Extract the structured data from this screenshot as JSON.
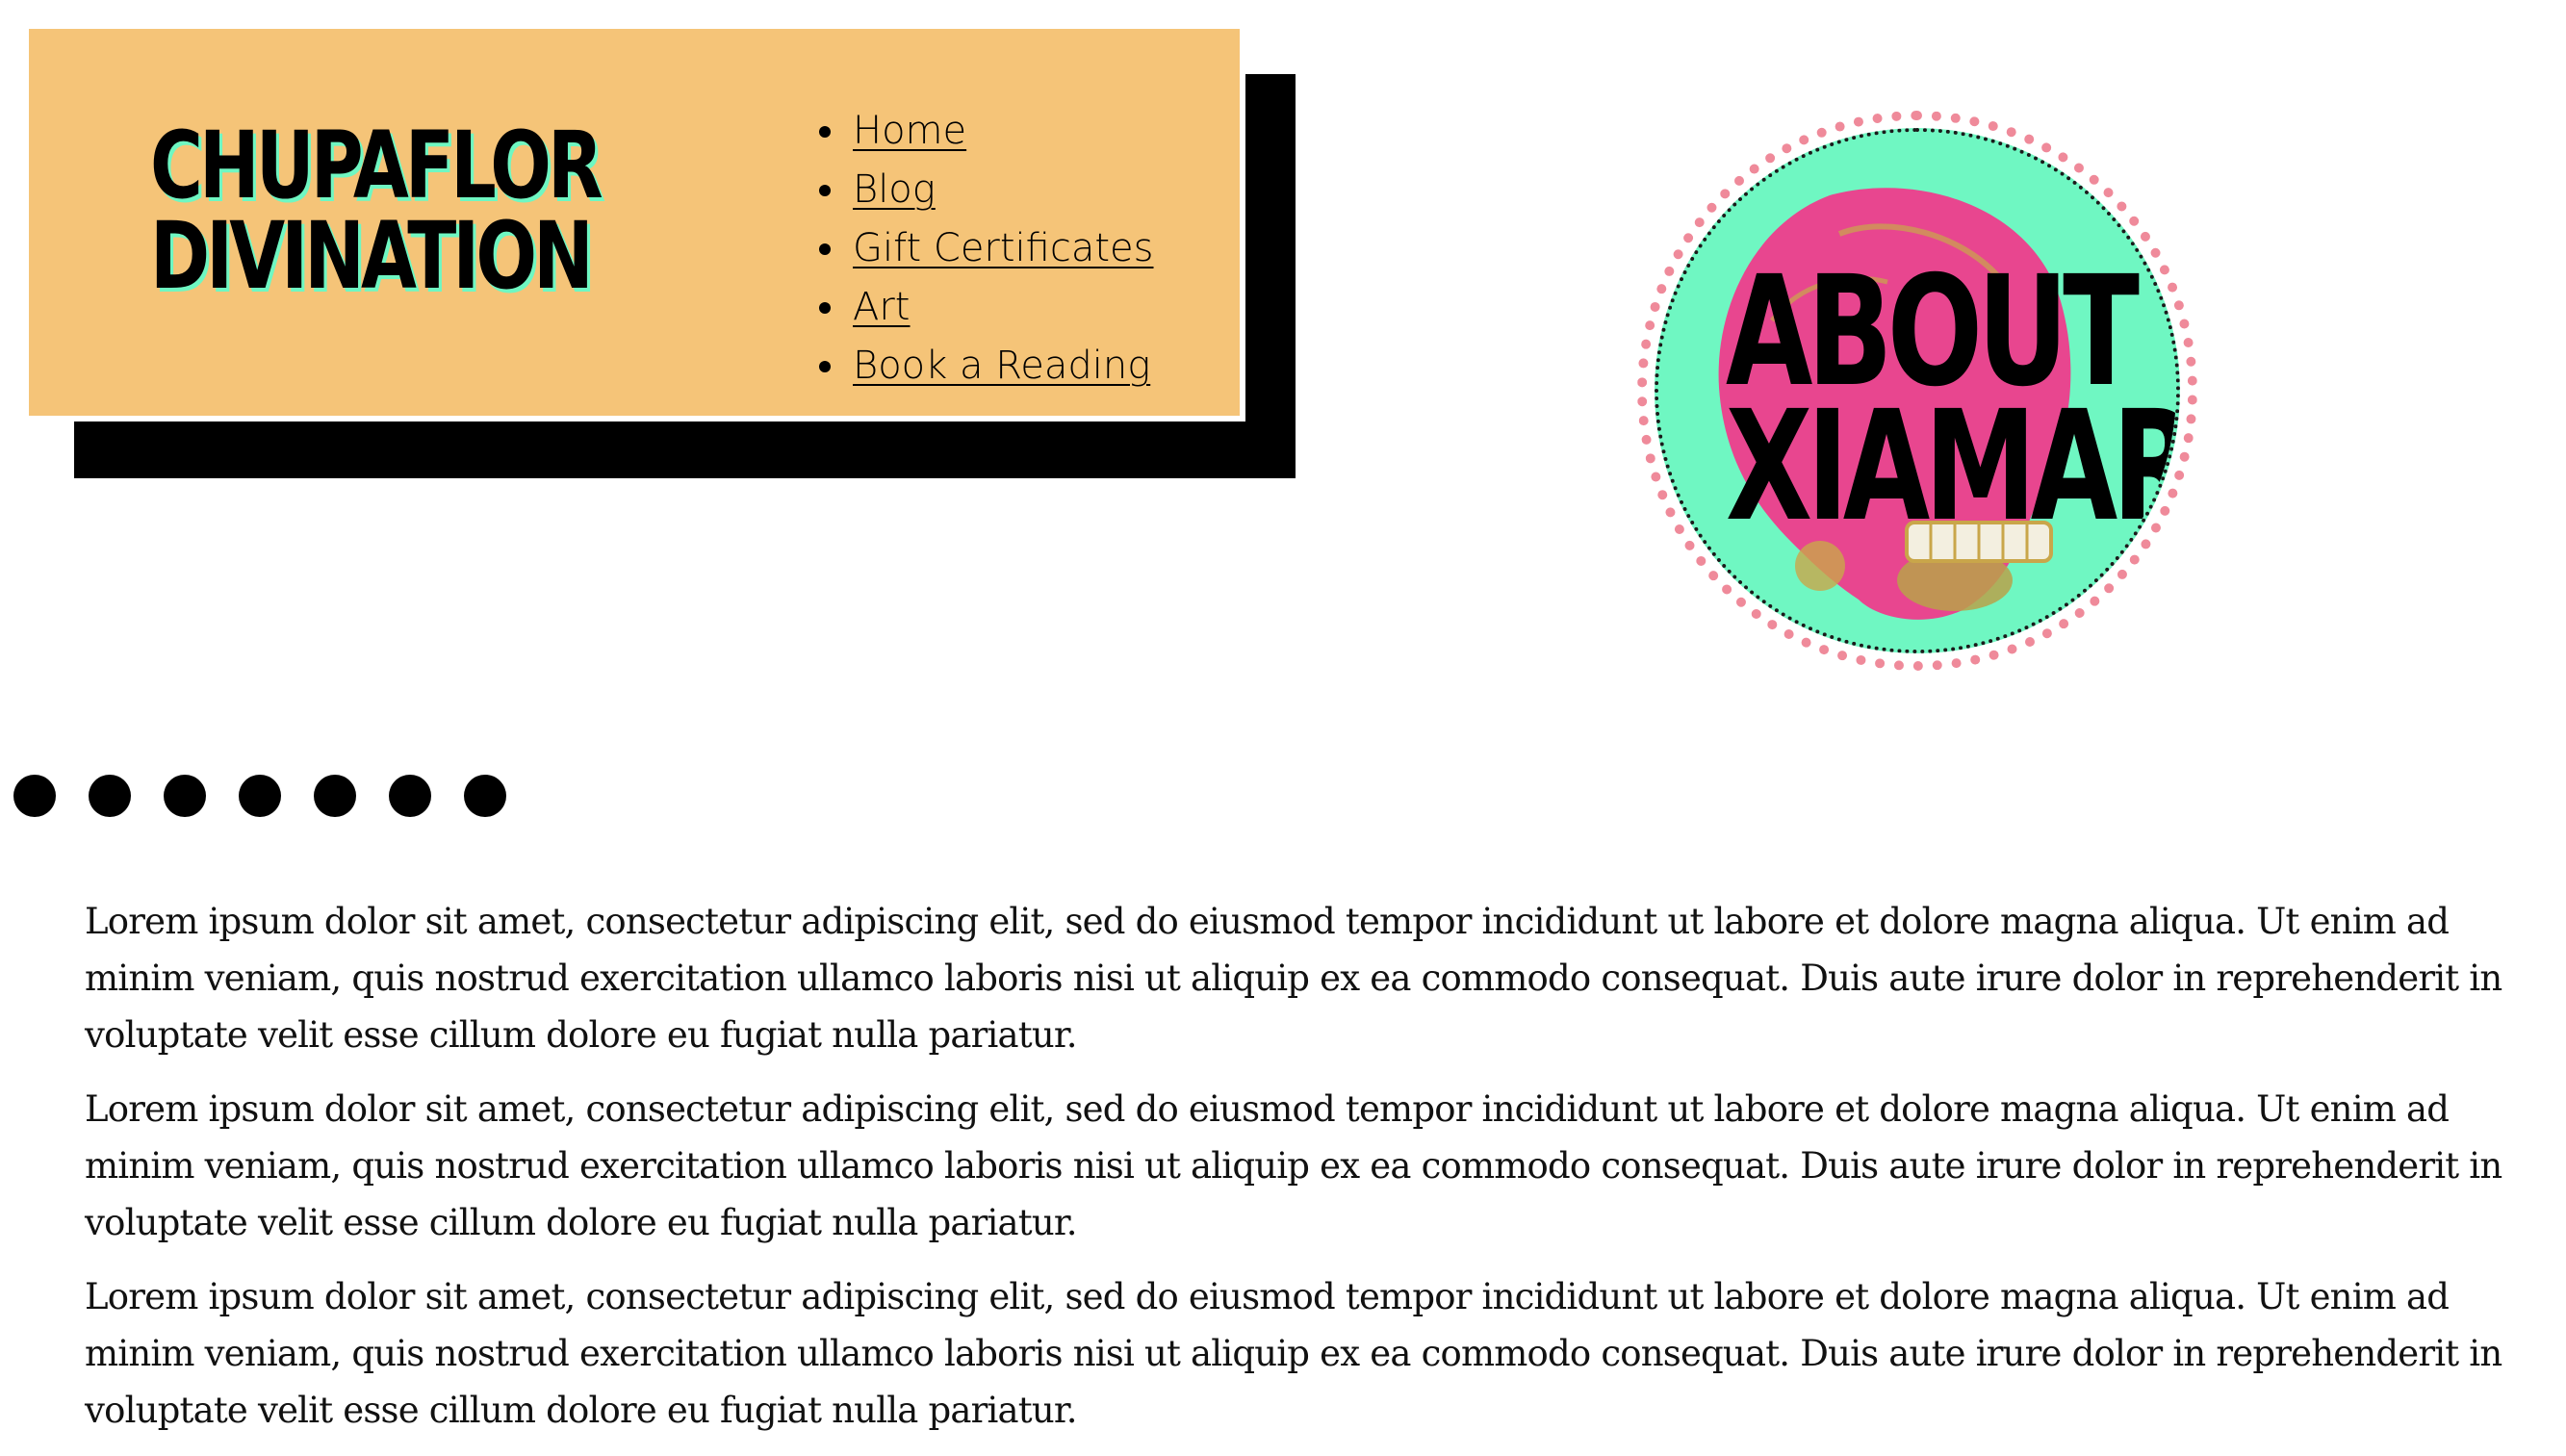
{
  "site": {
    "title_line1": "CHUPAFLOR",
    "title_line2": "DIVINATION"
  },
  "nav": {
    "items": [
      {
        "label": "Home"
      },
      {
        "label": "Blog"
      },
      {
        "label": "Gift Certificates"
      },
      {
        "label": "Art"
      },
      {
        "label": "Book a Reading"
      }
    ]
  },
  "badge": {
    "line1": "ABOUT",
    "line2": "XIAMARA"
  },
  "decor": {
    "dot_count": 7
  },
  "content": {
    "paragraphs": [
      "Lorem ipsum dolor sit amet, consectetur adipiscing elit, sed do eiusmod tempor incididunt ut labore et dolore magna aliqua. Ut enim ad minim veniam, quis nostrud exercitation ullamco laboris nisi ut aliquip ex ea commodo consequat. Duis aute irure dolor in reprehenderit in voluptate velit esse cillum dolore eu fugiat nulla pariatur.",
      "Lorem ipsum dolor sit amet, consectetur adipiscing elit, sed do eiusmod tempor incididunt ut labore et dolore magna aliqua. Ut enim ad minim veniam, quis nostrud exercitation ullamco laboris nisi ut aliquip ex ea commodo consequat. Duis aute irure dolor in reprehenderit in voluptate velit esse cillum dolore eu fugiat nulla pariatur.",
      "Lorem ipsum dolor sit amet, consectetur adipiscing elit, sed do eiusmod tempor incididunt ut labore et dolore magna aliqua. Ut enim ad minim veniam, quis nostrud exercitation ullamco laboris nisi ut aliquip ex ea commodo consequat. Duis aute irure dolor in reprehenderit in voluptate velit esse cillum dolore eu fugiat nulla pariatur."
    ]
  },
  "colors": {
    "header_bg": "#f5c478",
    "header_shadow": "#000000",
    "accent_mint": "#6ff7c2",
    "badge_dots_pink": "#ef8a9a",
    "skull_pink": "#e8468f"
  }
}
